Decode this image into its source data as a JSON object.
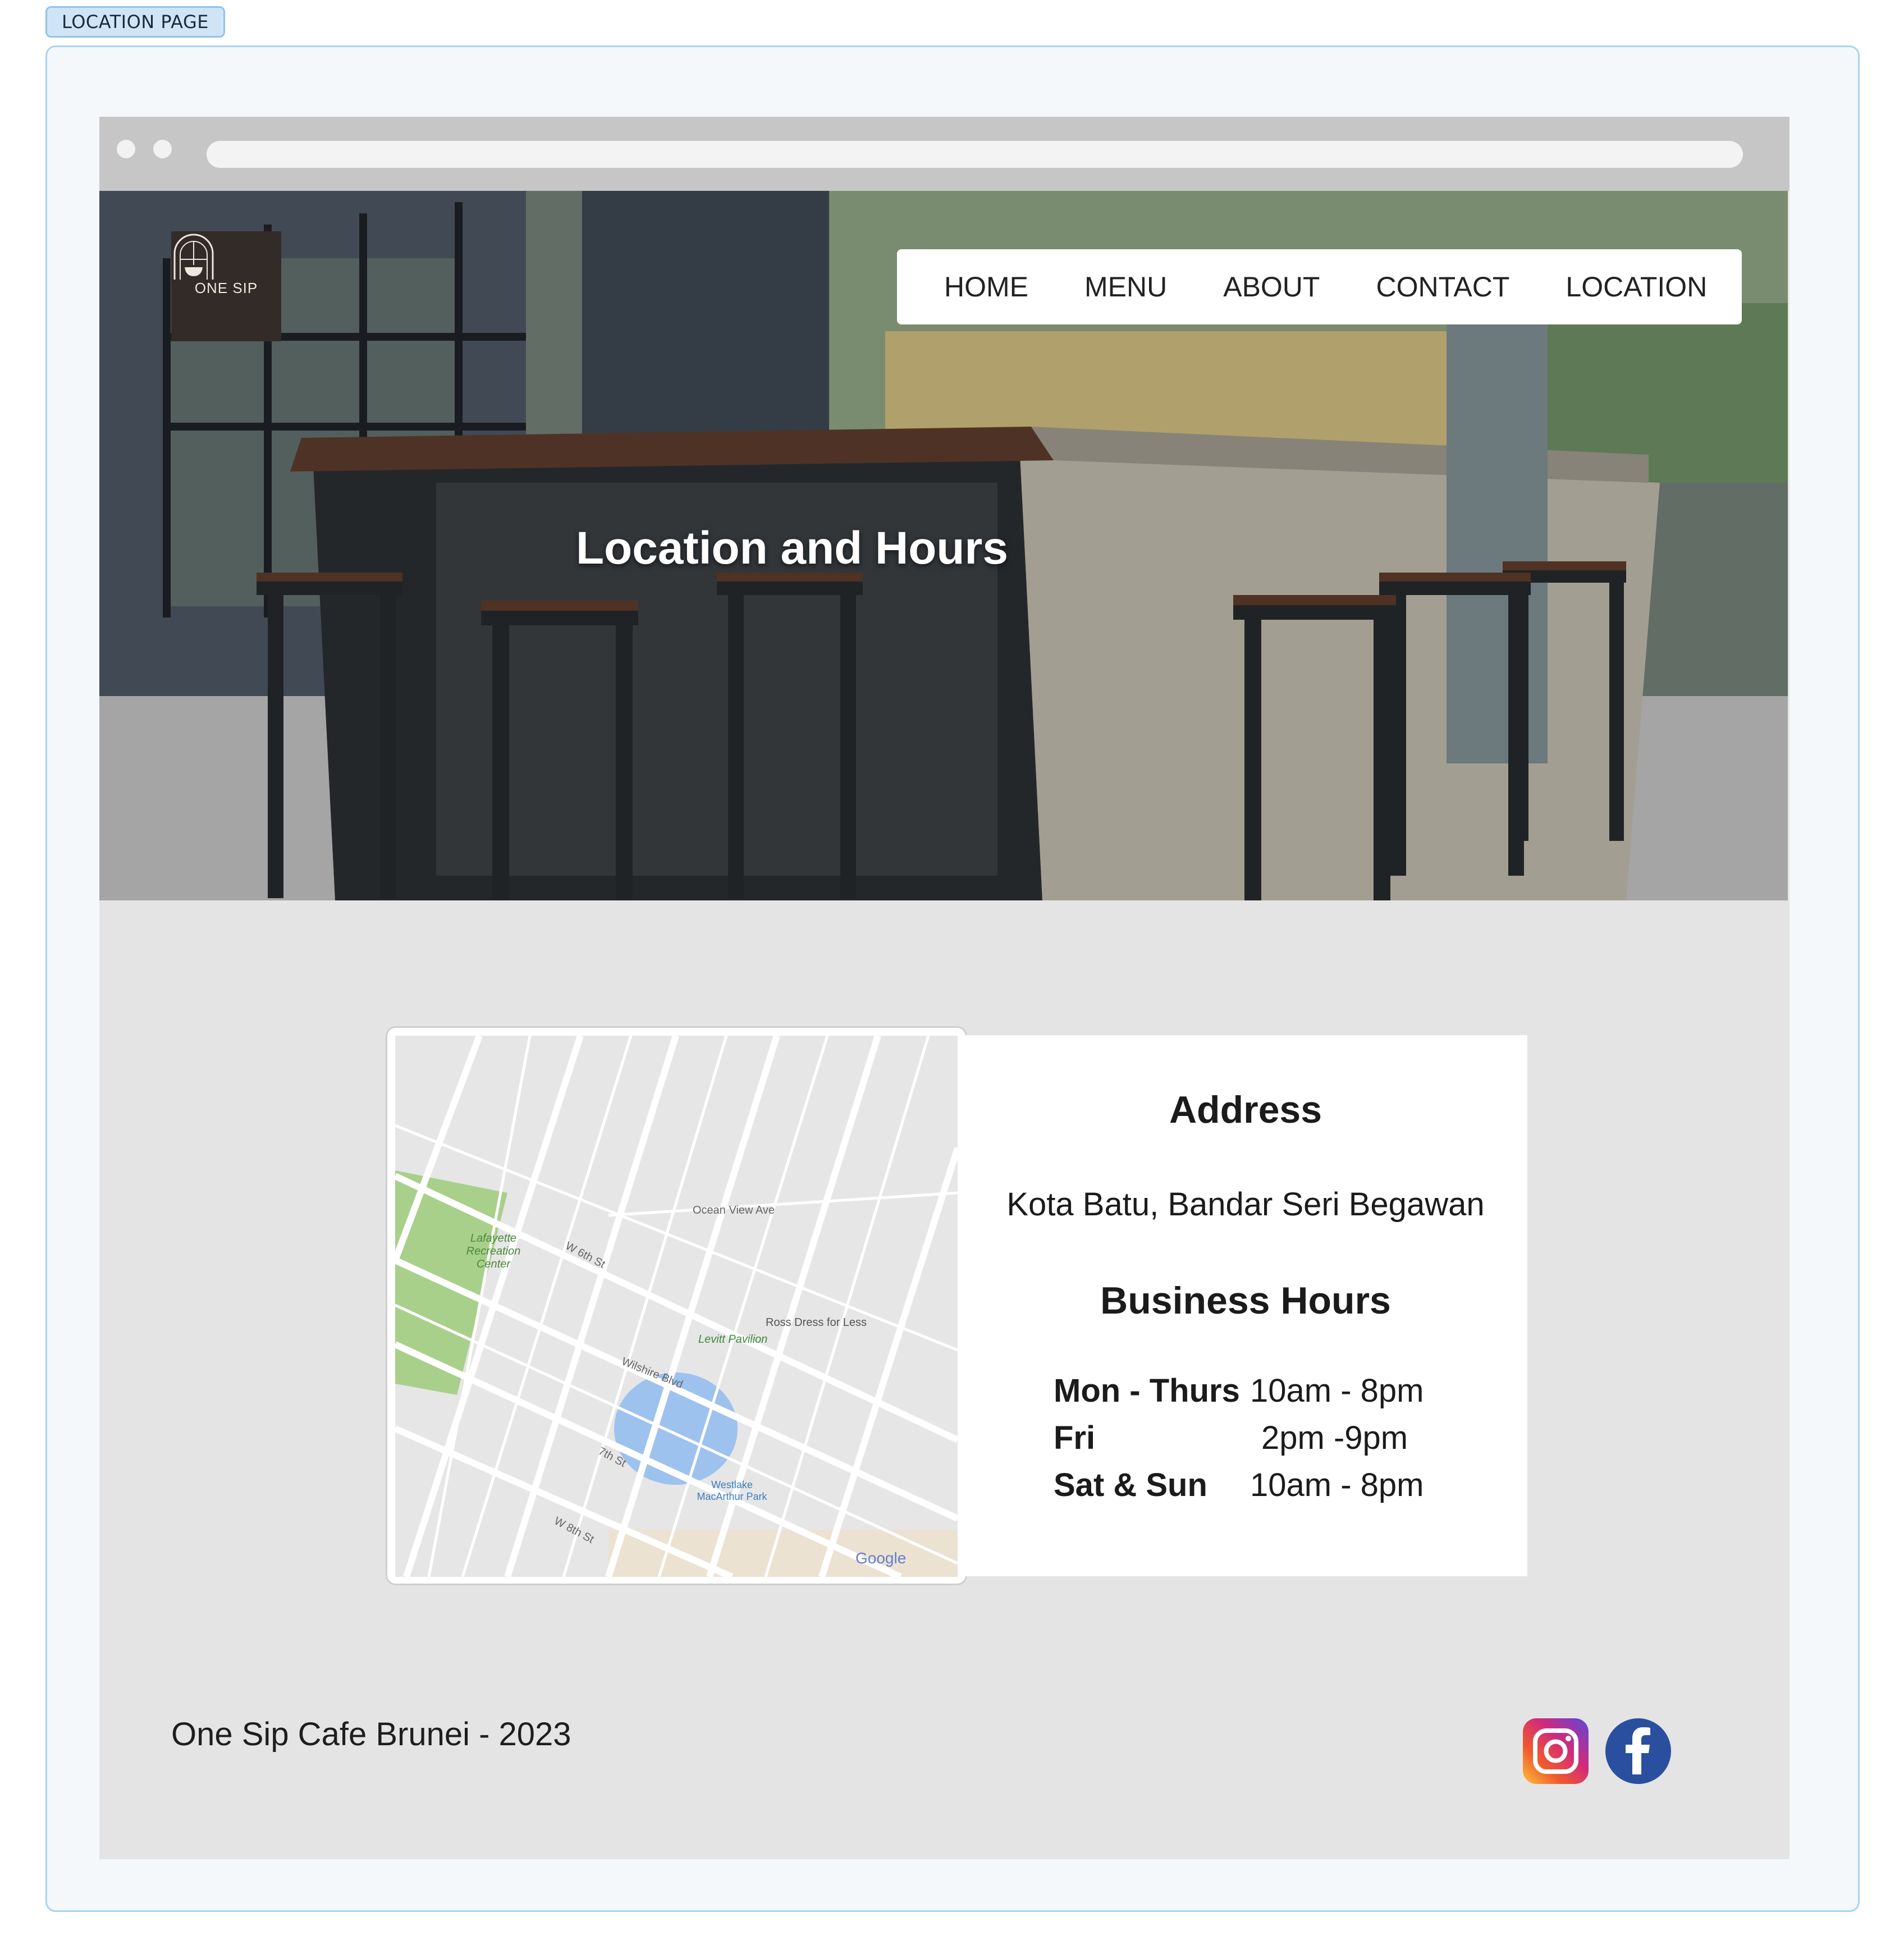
{
  "page_label": "LOCATION PAGE",
  "logo": {
    "text": "ONE SIP"
  },
  "nav": {
    "items": [
      {
        "label": "HOME"
      },
      {
        "label": "MENU"
      },
      {
        "label": "ABOUT"
      },
      {
        "label": "CONTACT"
      },
      {
        "label": "LOCATION"
      }
    ]
  },
  "hero": {
    "title": "Location and Hours"
  },
  "map": {
    "labels": {
      "park": "Lafayette Recreation Center",
      "store": "Ross Dress for Less",
      "pavilion": "Levitt Pavilion",
      "lake_park": "Westlake MacArthur Park",
      "ocean": "Ocean View Ave",
      "wilshire": "Wilshire Blvd",
      "w6": "W 6th St",
      "w7": "7th St",
      "w8": "W 8th St",
      "google": "Google"
    }
  },
  "address": {
    "heading": "Address",
    "text": "Kota Batu, Bandar Seri Begawan"
  },
  "hours": {
    "heading": "Business Hours",
    "rows": [
      {
        "day": "Mon - Thurs",
        "time": "10am - 8pm"
      },
      {
        "day": "Fri",
        "time": "2pm -9pm"
      },
      {
        "day": "Sat & Sun",
        "time": "10am - 8pm"
      }
    ]
  },
  "footer": {
    "text": "One Sip Cafe Brunei - 2023"
  },
  "social": [
    {
      "name": "instagram-icon"
    },
    {
      "name": "facebook-icon"
    }
  ],
  "colors": {
    "content_bg": "#e4e4e4",
    "chrome_bar": "#c6c6c6",
    "frame_border": "#a8d4f0",
    "facebook": "#2a4f9e"
  }
}
